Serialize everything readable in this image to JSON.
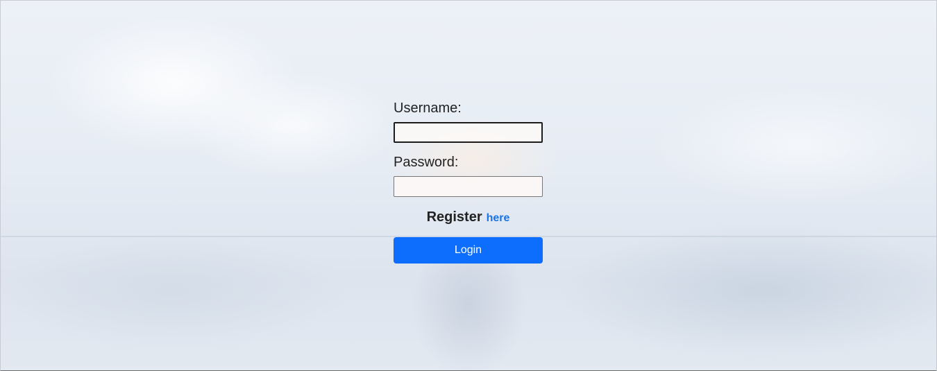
{
  "form": {
    "username_label": "Username:",
    "username_value": "",
    "password_label": "Password:",
    "password_value": "",
    "register_text": "Register",
    "register_link": "here",
    "login_button": "Login"
  },
  "colors": {
    "accent": "#0d6efd",
    "link": "#1a73e8"
  }
}
